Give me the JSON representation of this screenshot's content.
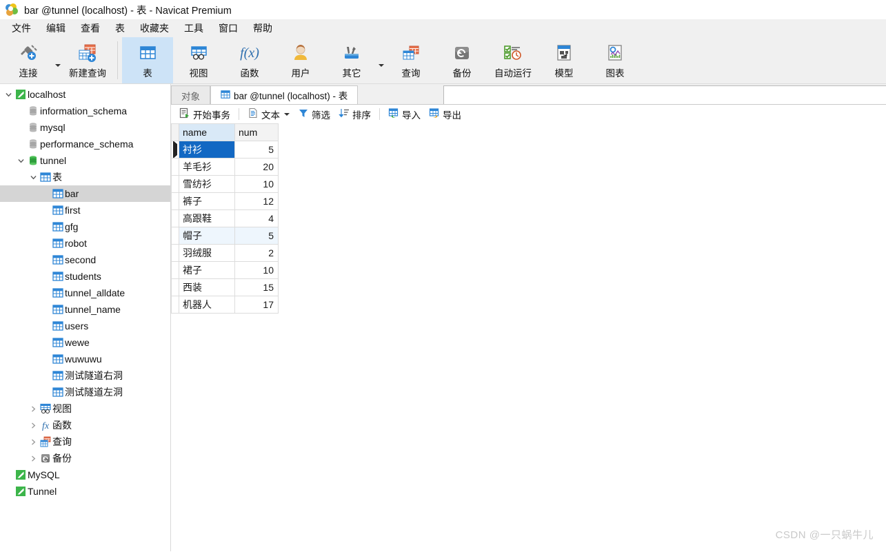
{
  "window": {
    "title": "bar @tunnel (localhost) - 表 - Navicat Premium",
    "logo_icon": "navicat-logo-icon"
  },
  "menubar": {
    "items": [
      {
        "label": "文件"
      },
      {
        "label": "编辑"
      },
      {
        "label": "查看"
      },
      {
        "label": "表"
      },
      {
        "label": "收藏夹"
      },
      {
        "label": "工具"
      },
      {
        "label": "窗口"
      },
      {
        "label": "帮助"
      }
    ]
  },
  "toolbar": {
    "buttons": [
      {
        "label": "连接",
        "icon": "plug-plus-icon",
        "active": false,
        "has_caret": true
      },
      {
        "label": "新建查询",
        "icon": "new-query-icon",
        "active": false,
        "has_caret": false
      },
      {
        "label": "表",
        "icon": "table-icon",
        "active": true,
        "has_caret": false
      },
      {
        "label": "视图",
        "icon": "view-icon",
        "active": false,
        "has_caret": false
      },
      {
        "label": "函数",
        "icon": "function-fx-icon",
        "active": false,
        "has_caret": false
      },
      {
        "label": "用户",
        "icon": "user-icon",
        "active": false,
        "has_caret": false
      },
      {
        "label": "其它",
        "icon": "other-tools-icon",
        "active": false,
        "has_caret": true
      },
      {
        "label": "查询",
        "icon": "query-icon",
        "active": false,
        "has_caret": false
      },
      {
        "label": "备份",
        "icon": "backup-icon",
        "active": false,
        "has_caret": false
      },
      {
        "label": "自动运行",
        "icon": "automation-icon",
        "active": false,
        "has_caret": false
      },
      {
        "label": "模型",
        "icon": "model-icon",
        "active": false,
        "has_caret": false
      },
      {
        "label": "图表",
        "icon": "chart-icon",
        "active": false,
        "has_caret": false
      }
    ]
  },
  "sidebar": {
    "items": [
      {
        "label": "localhost",
        "icon": "mysql-connection-icon",
        "indent": 0,
        "twisty": "expanded",
        "selected": false
      },
      {
        "label": "information_schema",
        "icon": "database-gray-icon",
        "indent": 1,
        "twisty": "none",
        "selected": false
      },
      {
        "label": "mysql",
        "icon": "database-gray-icon",
        "indent": 1,
        "twisty": "none",
        "selected": false
      },
      {
        "label": "performance_schema",
        "icon": "database-gray-icon",
        "indent": 1,
        "twisty": "none",
        "selected": false
      },
      {
        "label": "tunnel",
        "icon": "database-green-icon",
        "indent": 1,
        "twisty": "expanded",
        "selected": false
      },
      {
        "label": "表",
        "icon": "table-icon",
        "indent": 2,
        "twisty": "expanded",
        "selected": false
      },
      {
        "label": "bar",
        "icon": "table-icon",
        "indent": 3,
        "twisty": "none",
        "selected": true
      },
      {
        "label": "first",
        "icon": "table-icon",
        "indent": 3,
        "twisty": "none",
        "selected": false
      },
      {
        "label": "gfg",
        "icon": "table-icon",
        "indent": 3,
        "twisty": "none",
        "selected": false
      },
      {
        "label": "robot",
        "icon": "table-icon",
        "indent": 3,
        "twisty": "none",
        "selected": false
      },
      {
        "label": "second",
        "icon": "table-icon",
        "indent": 3,
        "twisty": "none",
        "selected": false
      },
      {
        "label": "students",
        "icon": "table-icon",
        "indent": 3,
        "twisty": "none",
        "selected": false
      },
      {
        "label": "tunnel_alldate",
        "icon": "table-icon",
        "indent": 3,
        "twisty": "none",
        "selected": false
      },
      {
        "label": "tunnel_name",
        "icon": "table-icon",
        "indent": 3,
        "twisty": "none",
        "selected": false
      },
      {
        "label": "users",
        "icon": "table-icon",
        "indent": 3,
        "twisty": "none",
        "selected": false
      },
      {
        "label": "wewe",
        "icon": "table-icon",
        "indent": 3,
        "twisty": "none",
        "selected": false
      },
      {
        "label": "wuwuwu",
        "icon": "table-icon",
        "indent": 3,
        "twisty": "none",
        "selected": false
      },
      {
        "label": "测试隧道右洞",
        "icon": "table-icon",
        "indent": 3,
        "twisty": "none",
        "selected": false
      },
      {
        "label": "测试隧道左洞",
        "icon": "table-icon",
        "indent": 3,
        "twisty": "none",
        "selected": false
      },
      {
        "label": "视图",
        "icon": "view-icon",
        "indent": 2,
        "twisty": "collapsed",
        "selected": false
      },
      {
        "label": "函数",
        "icon": "function-fx-icon",
        "indent": 2,
        "twisty": "collapsed",
        "selected": false
      },
      {
        "label": "查询",
        "icon": "query-icon",
        "indent": 2,
        "twisty": "collapsed",
        "selected": false
      },
      {
        "label": "备份",
        "icon": "backup-icon",
        "indent": 2,
        "twisty": "collapsed",
        "selected": false
      },
      {
        "label": "MySQL",
        "icon": "mysql-connection-icon",
        "indent": 0,
        "twisty": "none",
        "selected": false
      },
      {
        "label": "Tunnel",
        "icon": "mysql-connection-icon",
        "indent": 0,
        "twisty": "none",
        "selected": false
      }
    ]
  },
  "tabs": [
    {
      "label": "对象",
      "icon": "none",
      "active": false
    },
    {
      "label": "bar @tunnel (localhost) - 表",
      "icon": "table-icon",
      "active": true
    }
  ],
  "grid_toolbar": {
    "buttons": [
      {
        "label": "开始事务",
        "icon": "begin-transaction-icon",
        "has_caret": false
      },
      {
        "label": "文本",
        "icon": "text-document-icon",
        "has_caret": true
      },
      {
        "label": "筛选",
        "icon": "filter-funnel-icon",
        "has_caret": false
      },
      {
        "label": "排序",
        "icon": "sort-icon",
        "has_caret": false
      },
      {
        "label": "导入",
        "icon": "import-icon",
        "has_caret": false
      },
      {
        "label": "导出",
        "icon": "export-icon",
        "has_caret": false
      }
    ]
  },
  "table_data": {
    "columns": [
      "name",
      "num"
    ],
    "rows": [
      {
        "name": "衬衫",
        "num": "5",
        "state": "selected"
      },
      {
        "name": "羊毛衫",
        "num": "20",
        "state": "normal"
      },
      {
        "name": "雪纺衫",
        "num": "10",
        "state": "normal"
      },
      {
        "name": "裤子",
        "num": "12",
        "state": "normal"
      },
      {
        "name": "高跟鞋",
        "num": "4",
        "state": "normal"
      },
      {
        "name": "帽子",
        "num": "5",
        "state": "hover"
      },
      {
        "name": "羽绒服",
        "num": "2",
        "state": "normal"
      },
      {
        "name": "裙子",
        "num": "10",
        "state": "normal"
      },
      {
        "name": "西装",
        "num": "15",
        "state": "normal"
      },
      {
        "name": "机器人",
        "num": "17",
        "state": "normal"
      }
    ]
  },
  "watermark": {
    "text": "CSDN @一只蜗牛儿"
  },
  "colors": {
    "accent_selection": "#1268c3",
    "toolbar_active": "#cde3f7",
    "tree_selected": "#d5d5d5",
    "header_highlight": "#d9e9f7"
  }
}
